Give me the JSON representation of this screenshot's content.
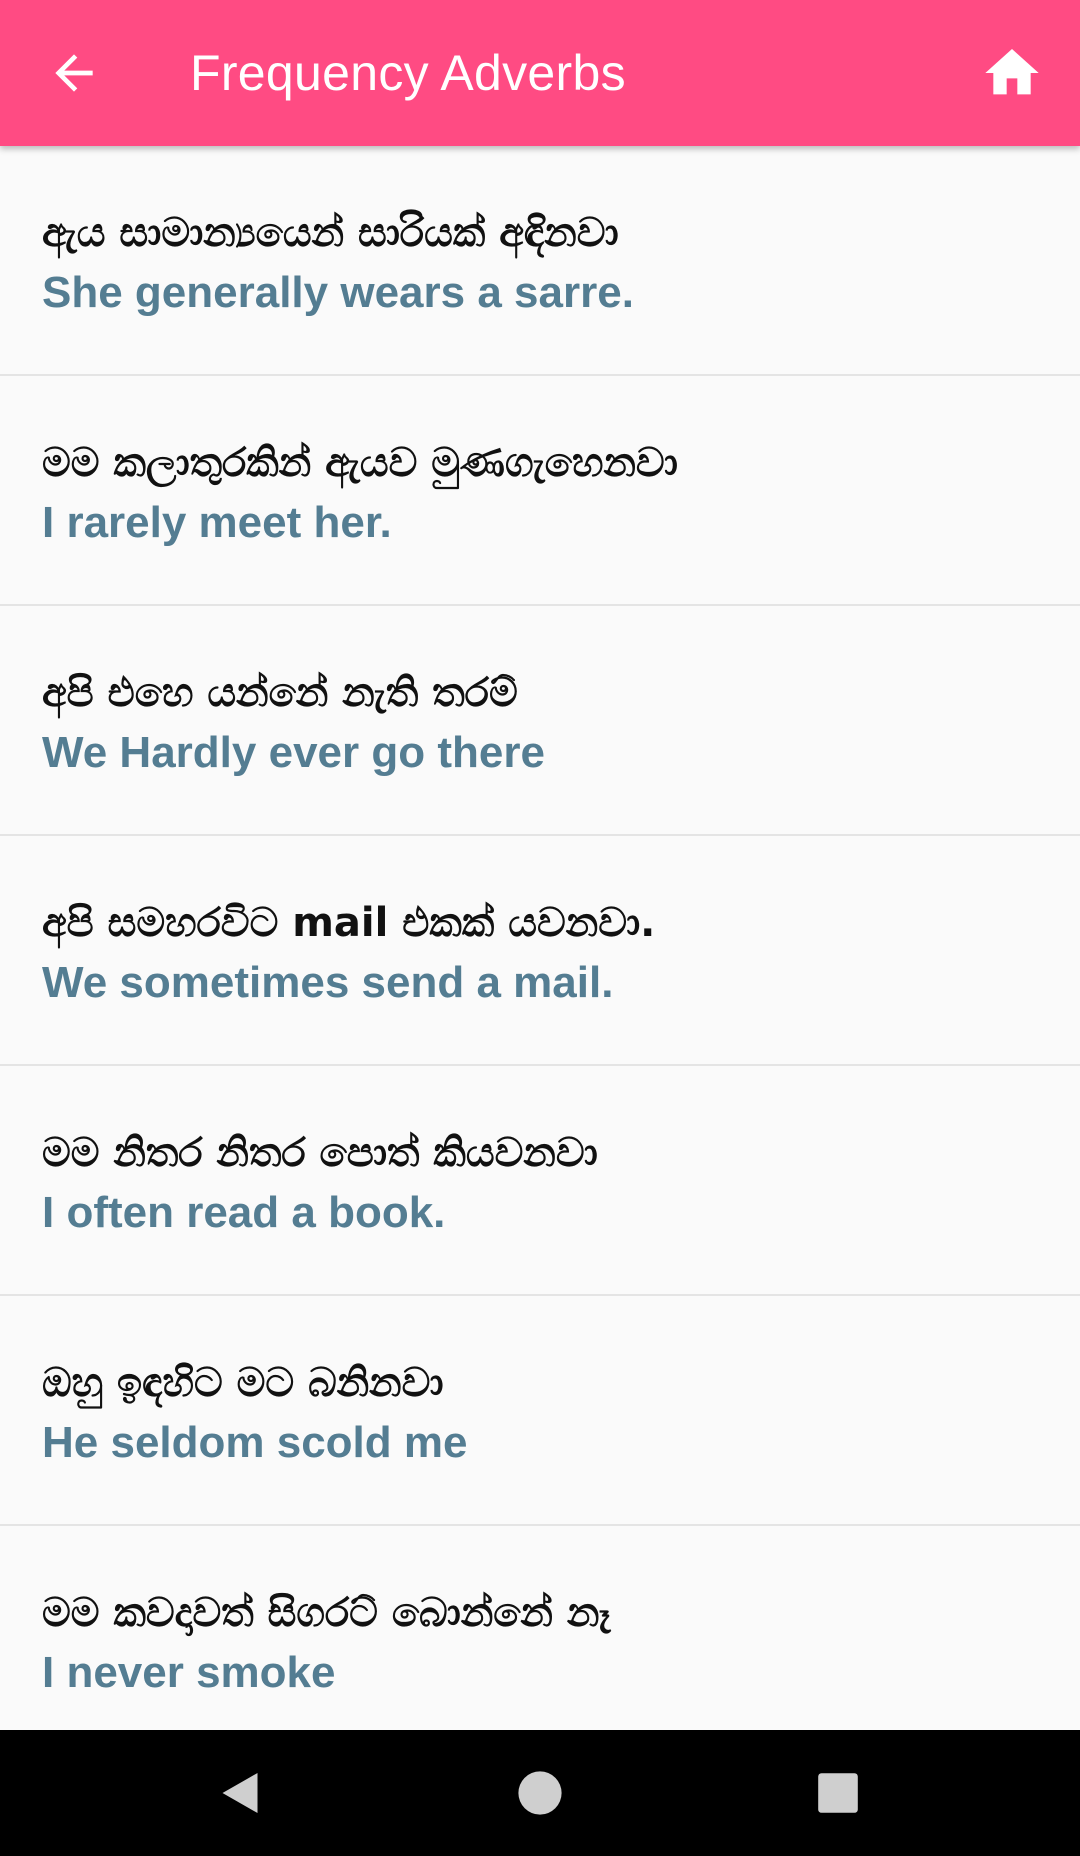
{
  "app_bar": {
    "title": "Frequency Adverbs",
    "back_icon": "arrow-back-icon",
    "home_icon": "home-icon",
    "background_color": "#ff4b83",
    "text_color": "#ffffff"
  },
  "phrases": [
    {
      "sinhala": "ඇය සාමාන්‍යයෙන් සාරියක් අඳිනවා",
      "english": "She generally wears a sarre."
    },
    {
      "sinhala": "මම කලාතුරකින් ඇයව මුණගැහෙනවා",
      "english": "I rarely meet her."
    },
    {
      "sinhala": "අපි එහෙ යන්නේ නැති තරම්",
      "english": "We Hardly ever go there"
    },
    {
      "sinhala": "අපි සමහරවිට mail එකක් යවනවා.",
      "english": "We sometimes send a mail."
    },
    {
      "sinhala": "මම නිතර නිතර පොත් කියවනවා",
      "english": "I often read a book."
    },
    {
      "sinhala": "ඔහු ඉඳහිට මට බනිනවා",
      "english": "He seldom scold me"
    },
    {
      "sinhala": "මම කවදාවත් සිගරට් බොන්නේ නෑ",
      "english": "I never smoke"
    }
  ],
  "colors": {
    "english_text": "#547d92",
    "sinhala_text": "#111111",
    "divider": "#e4e4e4",
    "background": "#fafafa"
  },
  "nav_bar": {
    "back_icon": "triangle-back-icon",
    "home_icon": "circle-home-icon",
    "recents_icon": "square-recents-icon"
  }
}
